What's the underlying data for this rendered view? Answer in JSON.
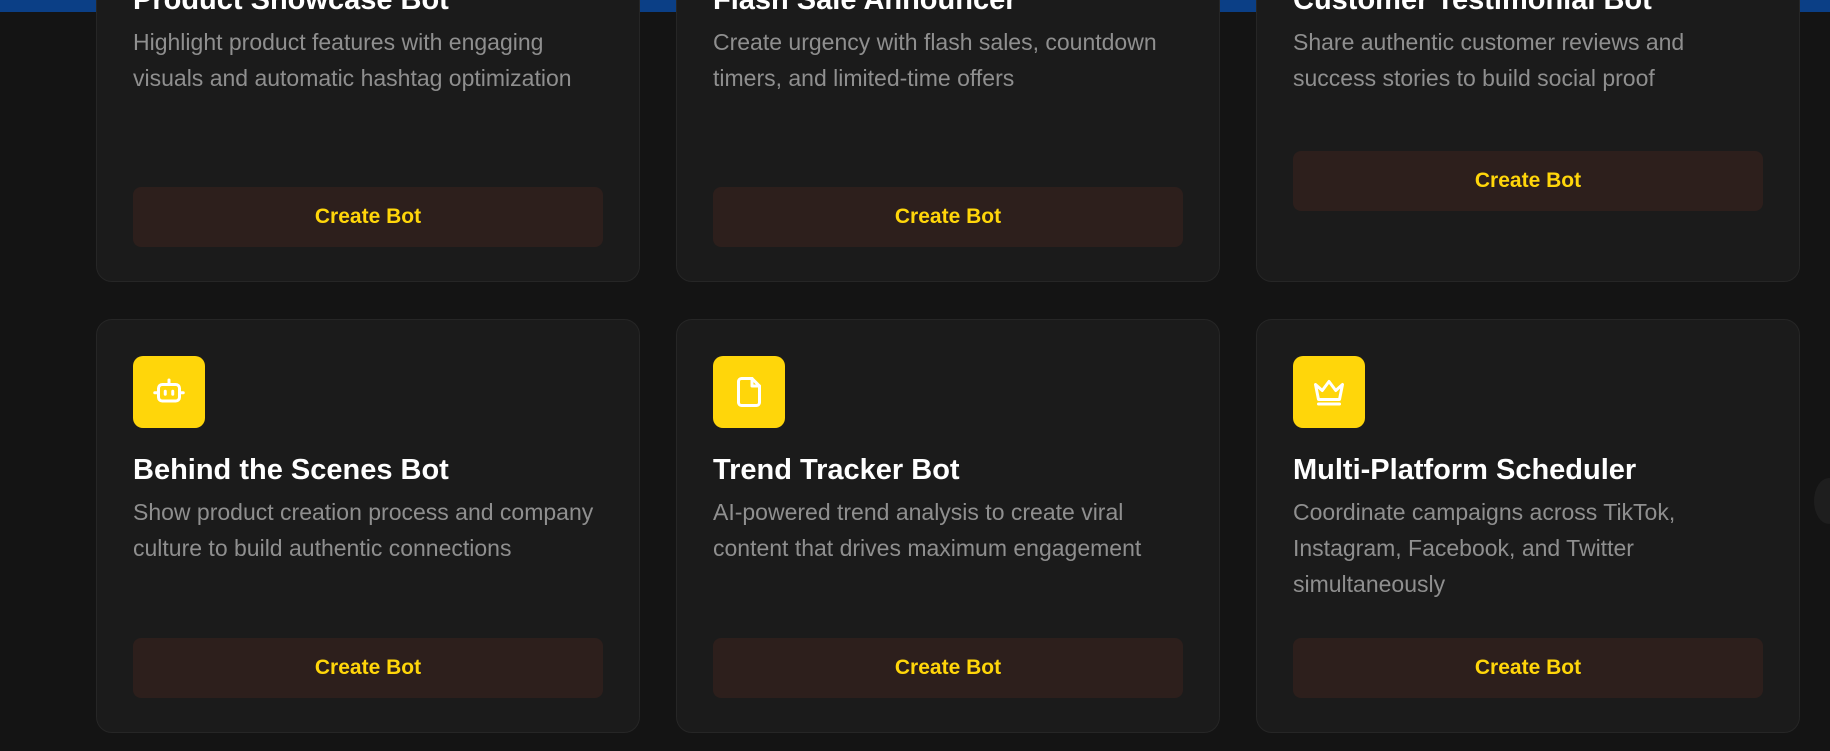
{
  "cards_row1": [
    {
      "title": "Product Showcase Bot",
      "description": "Highlight product features with engaging visuals and automatic hashtag optimization",
      "button_label": "Create Bot"
    },
    {
      "title": "Flash Sale Announcer",
      "description": "Create urgency with flash sales, countdown timers, and limited-time offers",
      "button_label": "Create Bot"
    },
    {
      "title": "Customer Testimonial Bot",
      "description": "Share authentic customer reviews and success stories to build social proof",
      "button_label": "Create Bot"
    }
  ],
  "cards_row2": [
    {
      "icon": "robot-icon",
      "title": "Behind the Scenes Bot",
      "description": "Show product creation process and company culture to build authentic connections",
      "button_label": "Create Bot"
    },
    {
      "icon": "file-icon",
      "title": "Trend Tracker Bot",
      "description": "AI-powered trend analysis to create viral content that drives maximum engagement",
      "button_label": "Create Bot"
    },
    {
      "icon": "crown-icon",
      "title": "Multi-Platform Scheduler",
      "description": "Coordinate campaigns across TikTok, Instagram, Facebook, and Twitter simultaneously",
      "button_label": "Create Bot"
    }
  ],
  "colors": {
    "accent": "#ffd60a",
    "background": "#141414",
    "card": "#1b1b1b",
    "button_bg": "#2d1f1c",
    "topbar": "#0b3f86"
  }
}
